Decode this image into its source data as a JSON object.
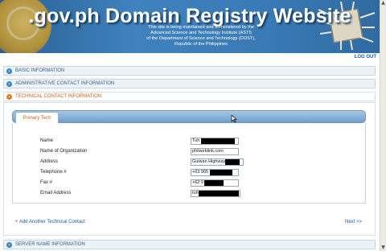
{
  "banner": {
    "title": ".gov.ph Domain Registry Website",
    "subtitle_lines": [
      "This site is being maintained and administered by the",
      "Advanced Science and Technology Institute (ASTI)",
      "of the Department of Science and Technology (DOST),",
      "Republic of the Philippines"
    ]
  },
  "header": {
    "logout_label": "LOG OUT"
  },
  "sections": [
    {
      "label": "BASIC INFORMATION",
      "expanded": false
    },
    {
      "label": "ADMINISTRATIVE CONTACT INFORMATION",
      "expanded": false
    },
    {
      "label": "TECHNICAL CONTACT INFORMATION",
      "expanded": true
    },
    {
      "label": "SERVER NAME INFORMATION",
      "expanded": false
    }
  ],
  "technical": {
    "tab_label": "Primary Tech",
    "fields": [
      {
        "label": "Name",
        "value": "Tuh"
      },
      {
        "label": "Name of Organization",
        "value": "philweblink.com"
      },
      {
        "label": "Address",
        "value": "Guiwan Highway"
      },
      {
        "label": "Telephone #",
        "value": "+63 905"
      },
      {
        "label": "Fax #",
        "value": "+62 9"
      },
      {
        "label": "Email Address",
        "value": "tuh"
      }
    ],
    "add_link": "+ Add Another Technical Contact",
    "next_link": "Next >>"
  },
  "colors": {
    "banner_blue": "#3f82bd",
    "link_blue": "#1a5aa0",
    "active_orange": "#c8621a"
  }
}
